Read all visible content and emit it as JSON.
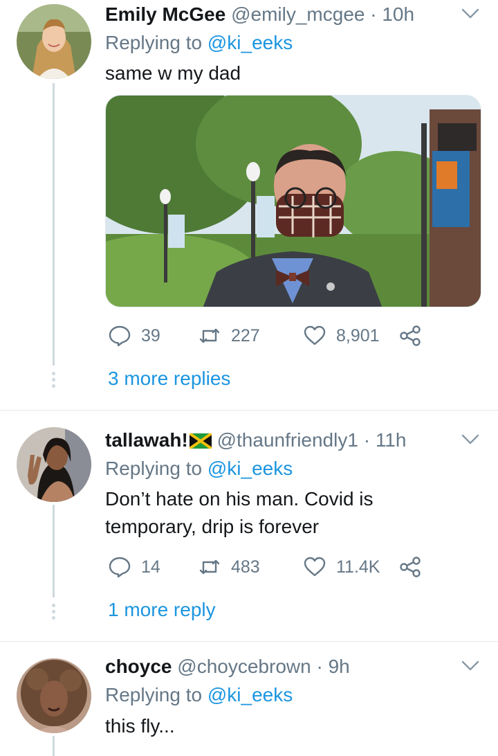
{
  "tweets": [
    {
      "name": "Emily McGee",
      "handle": "@emily_mcgee",
      "separator": "·",
      "time": "10h",
      "replying_prefix": "Replying to ",
      "replying_to": "@ki_eeks",
      "text": "same w my dad",
      "has_media": true,
      "counts": {
        "replies": "39",
        "retweets": "227",
        "likes": "8,901"
      },
      "more_replies": "3 more replies"
    },
    {
      "name": "tallawah!",
      "handle": "@thaunfriendly1",
      "separator": "·",
      "time": "11h",
      "replying_prefix": "Replying to ",
      "replying_to": "@ki_eeks",
      "text_line1": "Don’t hate on his man. Covid is",
      "text_line2": "temporary, drip is forever",
      "counts": {
        "replies": "14",
        "retweets": "483",
        "likes": "11.4K"
      },
      "more_replies": "1 more reply"
    },
    {
      "name": "choyce",
      "handle": "@choycebrown",
      "separator": "·",
      "time": "9h",
      "replying_prefix": "Replying to ",
      "replying_to": "@ki_eeks",
      "text": "this fly..."
    }
  ],
  "icons": {
    "reply": "speech-bubble-icon",
    "retweet": "retweet-icon",
    "like": "heart-icon",
    "share": "share-icon",
    "menu": "chevron-down-icon",
    "flag": "jamaica-flag-icon"
  },
  "colors": {
    "link": "#1b95e0",
    "secondary_text": "#657786",
    "divider": "#e1e8ed",
    "thread_line": "#cfd9de"
  }
}
